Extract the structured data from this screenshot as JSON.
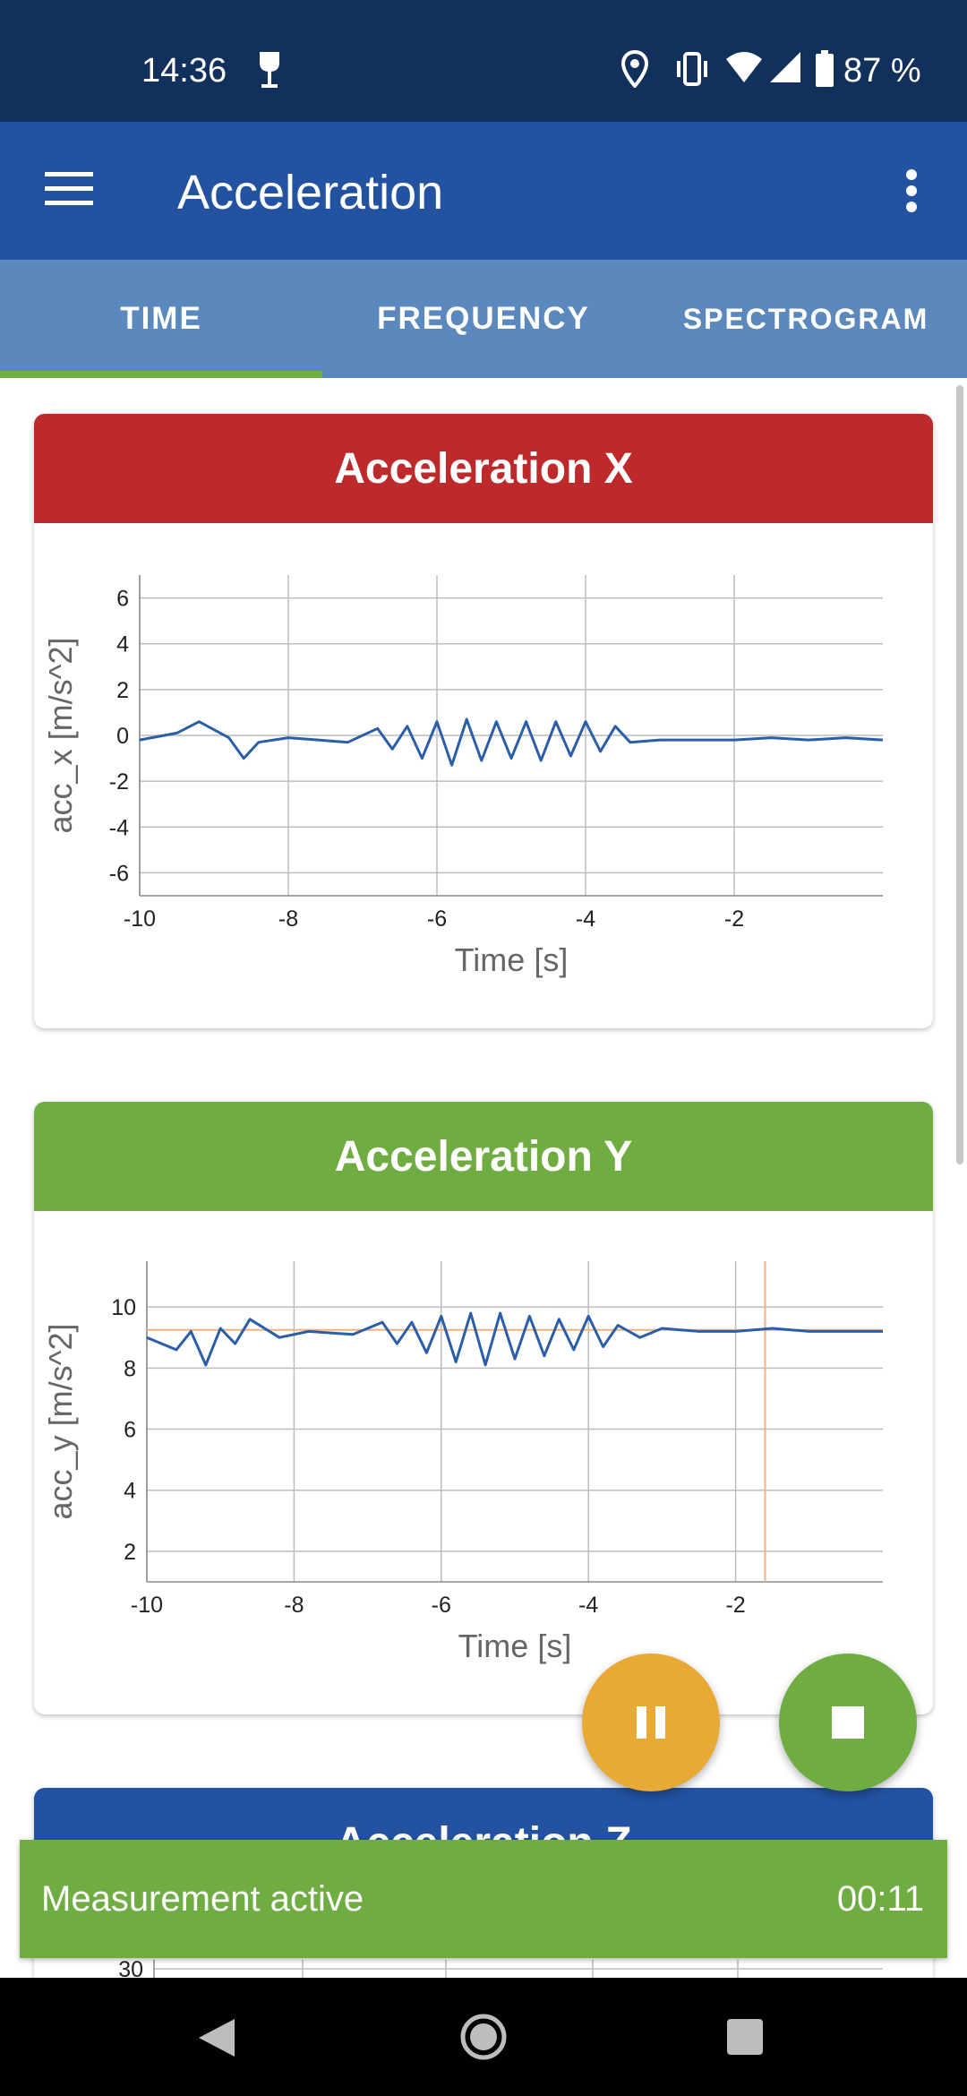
{
  "status_bar": {
    "time": "14:36",
    "battery": "87 %"
  },
  "app_bar": {
    "title": "Acceleration"
  },
  "tabs": [
    {
      "label": "TIME",
      "selected": true
    },
    {
      "label": "FREQUENCY",
      "selected": false
    },
    {
      "label": "SPECTROGRAM",
      "selected": false
    }
  ],
  "colors": {
    "x": "#bd2a2b",
    "y": "#6fad42",
    "z": "#2252a0",
    "line": "#2b5ea8",
    "marker": "#f0b37a"
  },
  "chart_data": [
    {
      "type": "line",
      "title": "Acceleration X",
      "xlabel": "Time [s]",
      "ylabel": "acc_x [m/s^2]",
      "xlim": [
        -10,
        0
      ],
      "ylim": [
        -7,
        7
      ],
      "xticks": [
        "-10",
        "-8",
        "-6",
        "-4",
        "-2"
      ],
      "yticks": [
        "6",
        "4",
        "2",
        "0",
        "-2",
        "-4",
        "-6"
      ],
      "series": [
        {
          "x": [
            -10,
            -9.5,
            -9.2,
            -8.8,
            -8.6,
            -8.4,
            -8.0,
            -7.6,
            -7.2,
            -6.8,
            -6.6,
            -6.4,
            -6.2,
            -6.0,
            -5.8,
            -5.6,
            -5.4,
            -5.2,
            -5.0,
            -4.8,
            -4.6,
            -4.4,
            -4.2,
            -4.0,
            -3.8,
            -3.6,
            -3.4,
            -3.0,
            -2.5,
            -2.0,
            -1.5,
            -1.0,
            -0.5,
            0
          ],
          "y": [
            -0.2,
            0.1,
            0.6,
            -0.1,
            -1.0,
            -0.3,
            -0.1,
            -0.2,
            -0.3,
            0.3,
            -0.6,
            0.4,
            -1.0,
            0.6,
            -1.3,
            0.7,
            -1.1,
            0.6,
            -1.0,
            0.6,
            -1.1,
            0.6,
            -0.9,
            0.6,
            -0.7,
            0.4,
            -0.3,
            -0.2,
            -0.2,
            -0.2,
            -0.1,
            -0.2,
            -0.1,
            -0.2
          ]
        }
      ]
    },
    {
      "type": "line",
      "title": "Acceleration Y",
      "xlabel": "Time [s]",
      "ylabel": "acc_y [m/s^2]",
      "xlim": [
        -10,
        0
      ],
      "ylim": [
        1,
        11.5
      ],
      "xticks": [
        "-10",
        "-8",
        "-6",
        "-4",
        "-2"
      ],
      "yticks": [
        "10",
        "8",
        "6",
        "4",
        "2"
      ],
      "series": [
        {
          "x": [
            -10,
            -9.6,
            -9.4,
            -9.2,
            -9.0,
            -8.8,
            -8.6,
            -8.2,
            -7.8,
            -7.2,
            -6.8,
            -6.6,
            -6.4,
            -6.2,
            -6.0,
            -5.8,
            -5.6,
            -5.4,
            -5.2,
            -5.0,
            -4.8,
            -4.6,
            -4.4,
            -4.2,
            -4.0,
            -3.8,
            -3.6,
            -3.3,
            -3.0,
            -2.5,
            -2.0,
            -1.5,
            -1.0,
            -0.5,
            0
          ],
          "y": [
            9.0,
            8.6,
            9.2,
            8.1,
            9.3,
            8.8,
            9.6,
            9.0,
            9.2,
            9.1,
            9.5,
            8.8,
            9.5,
            8.5,
            9.7,
            8.2,
            9.8,
            8.1,
            9.8,
            8.3,
            9.7,
            8.4,
            9.6,
            8.6,
            9.7,
            8.7,
            9.4,
            9.0,
            9.3,
            9.2,
            9.2,
            9.3,
            9.2,
            9.2,
            9.2
          ]
        }
      ],
      "reference_line_y": 9.25,
      "cursor_x": -1.6
    },
    {
      "type": "line",
      "title": "Acceleration Z",
      "yticks": [
        "30"
      ]
    }
  ],
  "fabs": {
    "pause": "pause-icon",
    "stop": "stop-icon"
  },
  "snackbar": {
    "text": "Measurement active",
    "timer": "00:11"
  }
}
